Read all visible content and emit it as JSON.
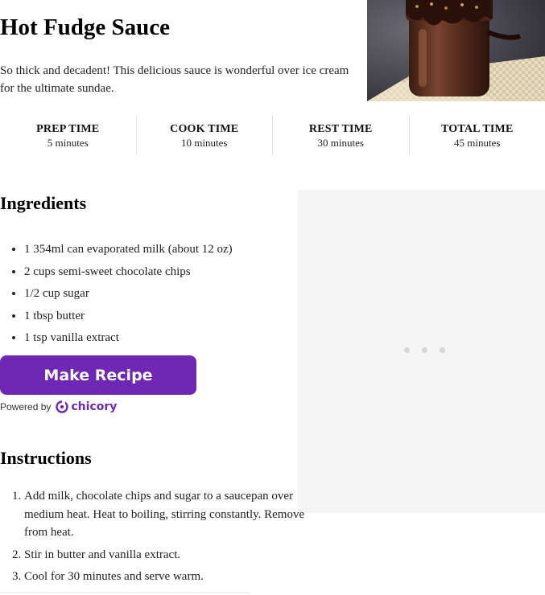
{
  "recipe": {
    "title": "Hot Fudge Sauce",
    "description": "So thick and decadent! This delicious sauce is wonderful over ice cream for the ultimate sundae."
  },
  "times": [
    {
      "label": "PREP TIME",
      "value": "5 minutes"
    },
    {
      "label": "COOK TIME",
      "value": "10 minutes"
    },
    {
      "label": "REST TIME",
      "value": "30 minutes"
    },
    {
      "label": "TOTAL TIME",
      "value": "45 minutes"
    }
  ],
  "ingredients": {
    "heading": "Ingredients",
    "items": [
      "1 354ml can evaporated milk (about 12 oz)",
      "2 cups semi-sweet chocolate chips",
      "1/2 cup sugar",
      "1 tbsp butter",
      "1 tsp vanilla extract"
    ]
  },
  "make_recipe": {
    "button_label": "Make Recipe",
    "powered_by": "Powered by",
    "brand": "chicory"
  },
  "instructions": {
    "heading": "Instructions",
    "steps": [
      "Add milk, chocolate chips and sugar to a saucepan over medium heat. Heat to boiling, stirring constantly. Remove from heat.",
      "Stir in butter and vanilla extract.",
      "Cool for 30 minutes and serve warm."
    ]
  },
  "colors": {
    "brand_purple": "#6f28b3",
    "ad_background": "#f5f5f5"
  }
}
